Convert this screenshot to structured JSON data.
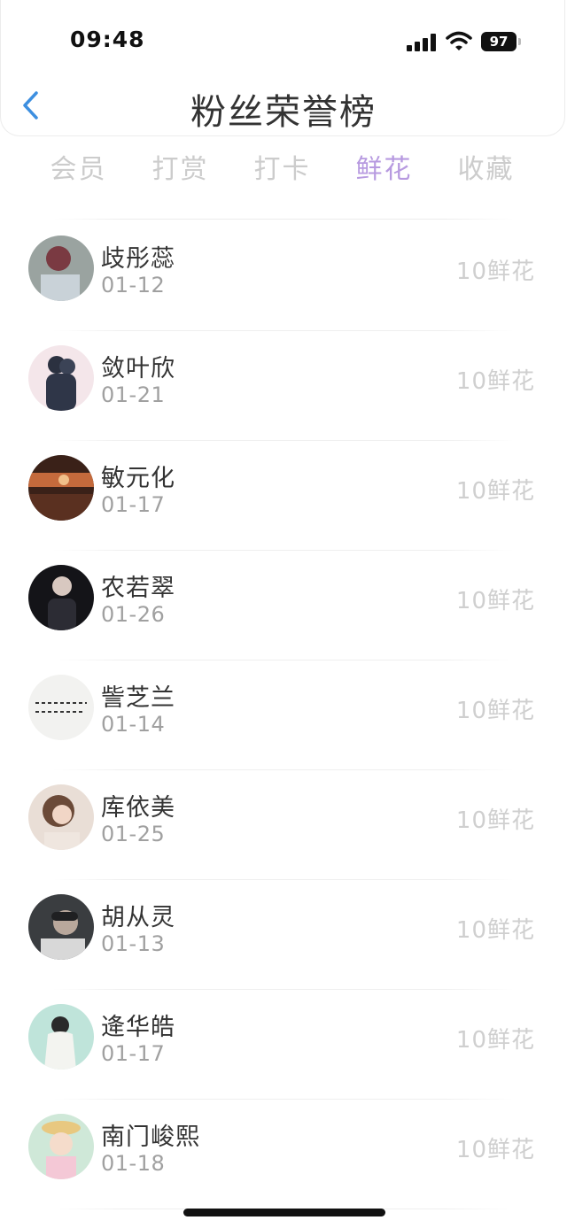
{
  "status_bar": {
    "time": "09:48",
    "battery": "97"
  },
  "header": {
    "title": "粉丝荣誉榜"
  },
  "tabs": [
    {
      "label": "会员",
      "active": false
    },
    {
      "label": "打赏",
      "active": false
    },
    {
      "label": "打卡",
      "active": false
    },
    {
      "label": "鲜花",
      "active": true
    },
    {
      "label": "收藏",
      "active": false
    }
  ],
  "list": [
    {
      "name": "歧彤蕊",
      "date": "01-12",
      "amount": "10鲜花"
    },
    {
      "name": "敛叶欣",
      "date": "01-21",
      "amount": "10鲜花"
    },
    {
      "name": "敏元化",
      "date": "01-17",
      "amount": "10鲜花"
    },
    {
      "name": "农若翠",
      "date": "01-26",
      "amount": "10鲜花"
    },
    {
      "name": "訾芝兰",
      "date": "01-14",
      "amount": "10鲜花"
    },
    {
      "name": "库依美",
      "date": "01-25",
      "amount": "10鲜花"
    },
    {
      "name": "胡从灵",
      "date": "01-13",
      "amount": "10鲜花"
    },
    {
      "name": "逄华皓",
      "date": "01-17",
      "amount": "10鲜花"
    },
    {
      "name": "南门峻熙",
      "date": "01-18",
      "amount": "10鲜花"
    }
  ],
  "colors": {
    "accent": "#b79ae0",
    "tab_inactive": "#cccccc",
    "amount": "#cfcfcf",
    "back": "#3d8fe0"
  }
}
